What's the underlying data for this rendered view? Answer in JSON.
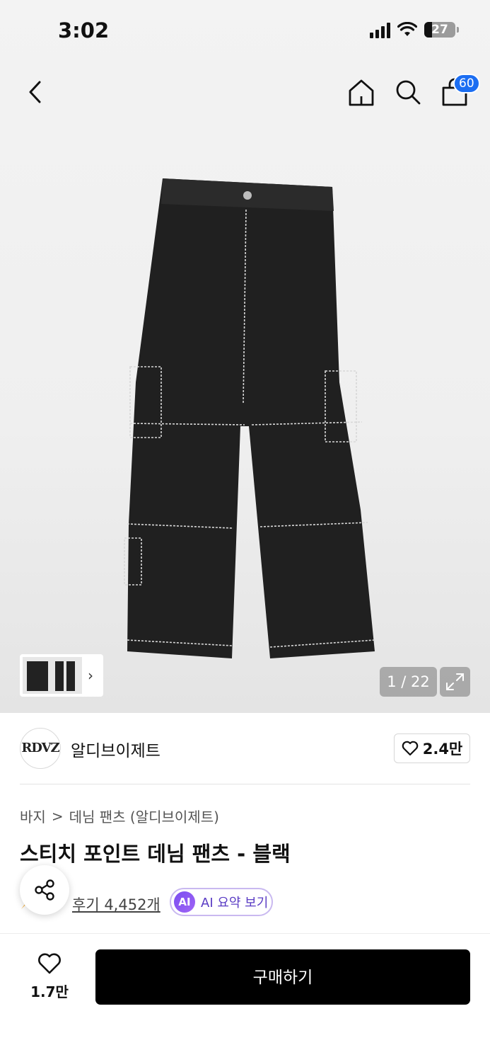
{
  "status_bar": {
    "time": "3:02",
    "battery": "27"
  },
  "header": {
    "cart_count": "60"
  },
  "gallery": {
    "counter": "1 / 22"
  },
  "brand": {
    "logo_text": "RDVZ",
    "name": "알디브이제트",
    "like_count": "2.4만"
  },
  "breadcrumb": {
    "category": "바지",
    "separator": ">",
    "subcategory": "데님 팬츠 (알디브이제트)"
  },
  "product": {
    "title": "스티치 포인트 데님 팬츠 - 블랙"
  },
  "reviews": {
    "link_text": "후기 4,452개",
    "ai_badge": "AI",
    "ai_label": "AI 요약 보기"
  },
  "bottom": {
    "like_count": "1.7만",
    "buy_label": "구매하기"
  },
  "colors": {
    "accent_blue": "#1c6ef2",
    "ai_purple": "#7a4ef0",
    "buy_black": "#000000"
  }
}
